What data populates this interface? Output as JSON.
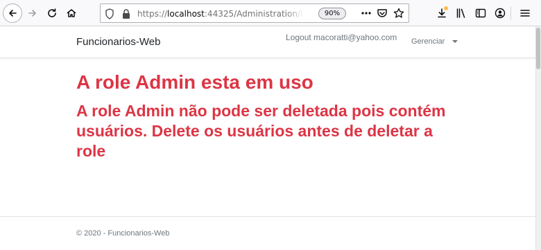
{
  "browser": {
    "url_prefix": "https://",
    "url_host": "localhost",
    "url_rest": ":44325/Administration/Delete",
    "zoom": "90%",
    "icons": {
      "back": "back-arrow-icon",
      "forward": "forward-arrow-icon",
      "reload": "reload-icon",
      "home": "home-icon",
      "shield": "tracking-shield-icon",
      "lock": "lock-icon",
      "more": "more-actions-icon",
      "pocket": "pocket-icon",
      "bookmark": "bookmark-star-icon",
      "downloads": "download-icon",
      "library": "library-icon",
      "sidebar": "sidebar-icon",
      "account": "account-icon",
      "menu": "hamburger-menu-icon"
    },
    "download_badge_color": "#ffbd4f"
  },
  "navbar": {
    "brand": "Funcionarios-Web",
    "logout": "Logout macoratti@yahoo.com",
    "manage": "Gerenciar"
  },
  "main": {
    "title": "A role Admin esta em uso",
    "message": "A role Admin não pode ser deletada pois contém usuários. Delete os usuários antes de deletar a role",
    "text_color": "#dc3545"
  },
  "footer": {
    "text": "© 2020 - Funcionarios-Web"
  }
}
